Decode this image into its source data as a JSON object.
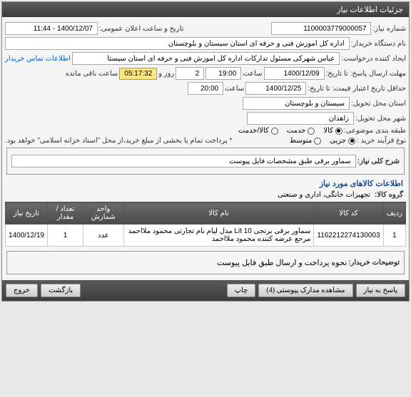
{
  "panel_title": "جزئیات اطلاعات نیاز",
  "fields": {
    "need_number_label": "شماره نیاز:",
    "need_number": "1100003779000057",
    "announce_label": "تاریخ و ساعت اعلان عمومی:",
    "announce_datetime": "1400/12/07 - 11:44",
    "buyer_label": "نام دستگاه خریدار:",
    "buyer": "اداره کل اموزش فنی و حرفه ای استان سیستان و بلوچستان",
    "creator_label": "ایجاد کننده درخواست:",
    "creator": "عباس شهرکی مسئول تدارکات اداره کل اموزش فنی و حرفه ای استان سیستا",
    "contact_link": "اطلاعات تماس خریدار",
    "deadline_label": "مهلت ارسال پاسخ: تا تاریخ:",
    "deadline_date": "1400/12/09",
    "time_label1": "ساعت",
    "deadline_time": "19:00",
    "days_val": "2",
    "days_label": "روز و",
    "countdown": "05:17:32",
    "remaining_label": "ساعت باقی مانده",
    "validity_label": "حداقل تاریخ اعتبار قیمت: تا تاریخ:",
    "validity_date": "1400/12/25",
    "validity_time": "20:00",
    "province_label": "استان محل تحویل:",
    "province": "سیستان و بلوچستان",
    "city_label": "شهر محل تحویل:",
    "city": "زاهدان",
    "category_label": "طبقه بندی موضوعی:",
    "cat_goods": "کالا",
    "cat_service": "خدمت",
    "cat_goods_service": "کالا/خدمت",
    "process_label": "نوع فرآیند خرید :",
    "proc_small": "جزیی",
    "proc_medium": "متوسط",
    "payment_note": "* پرداخت تمام یا بخشی از مبلغ خرید،از محل \"اسناد خزانه اسلامی\" خواهد بود.",
    "desc_label": "شرح کلی نیاز:",
    "desc": "سماور برقی طبق مشخصات فایل پیوست",
    "goods_section": "اطلاعات کالاهای مورد نیاز",
    "group_label": "گروه کالا:",
    "group": "تجهیزات خانگی، اداری و صنعتی",
    "buyer_notes_label": "توضیحات خریدار:",
    "buyer_notes": "نحوه پرداخت و ارسال طبق فایل پیوست"
  },
  "table": {
    "headers": {
      "row": "ردیف",
      "code": "کد کالا",
      "name": "نام کالا",
      "unit": "واحد شمارش",
      "qty": "تعداد / مقدار",
      "date": "تاریخ نیاز"
    },
    "rows": [
      {
        "row": "1",
        "code": "1162212274130003",
        "name": "سماور برقی برنجی 10 Lit مدل لیام نام تجارتی محمود ملااحمد مرجع عرضه کننده محمود ملااحمد",
        "unit": "عدد",
        "qty": "1",
        "date": "1400/12/19"
      }
    ]
  },
  "buttons": {
    "respond": "پاسخ به نیاز",
    "attachments": "مشاهده مدارک پیوستی (4)",
    "print": "چاپ",
    "back": "بازگشت",
    "exit": "خروج"
  }
}
